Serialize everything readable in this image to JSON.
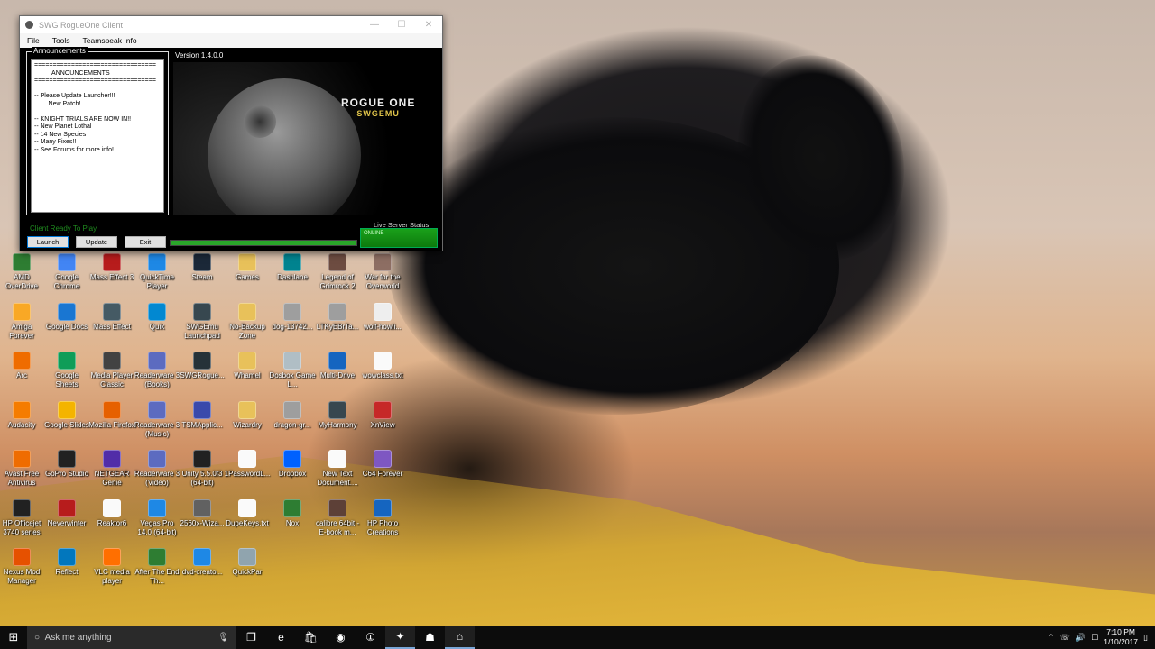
{
  "window": {
    "title": "SWG RogueOne Client",
    "controls": [
      "—",
      "☐",
      "✕"
    ],
    "menu": [
      "File",
      "Tools",
      "Teamspeak Info"
    ],
    "version": "Version 1.4.0.0",
    "announcements_label": "Announcements",
    "announcements_text": "=================================\n          ANNOUNCEMENTS\n=================================\n\n-- Please Update Launcher!!!\n        New Patch!\n\n-- KNIGHT TRIALS ARE NOW IN!!\n-- New Planet Lothal\n-- 14 New Species\n-- Many Fixes!!\n-- See Forums for more info!",
    "logo_line1": "ROGUE ONE",
    "logo_line2": "SWGEMU",
    "status": "Client Ready To Play",
    "buttons": {
      "launch": "Launch",
      "update": "Update",
      "exit": "Exit"
    },
    "progress_fraction": 1.0,
    "server_status_label": "Live Server Status",
    "server_status_value": "ONLINE"
  },
  "desktop_icons": [
    {
      "label": "AMD OverDrive",
      "color": "#2e7d32",
      "icon": "amd-icon"
    },
    {
      "label": "Google Chrome",
      "color": "#4285f4",
      "icon": "chrome-icon"
    },
    {
      "label": "Mass Effect 3",
      "color": "#b71c1c",
      "icon": "mass-effect-3-icon"
    },
    {
      "label": "QuickTime Player",
      "color": "#1e88e5",
      "icon": "quicktime-icon"
    },
    {
      "label": "Steam",
      "color": "#1b2838",
      "icon": "steam-icon"
    },
    {
      "label": "Games",
      "color": "#e8c15a",
      "icon": "folder-icon"
    },
    {
      "label": "Dashlane",
      "color": "#00838f",
      "icon": "dashlane-icon"
    },
    {
      "label": "Legend of Grimrock 2",
      "color": "#6d4c41",
      "icon": "grimrock-icon"
    },
    {
      "label": "War for the Overworld",
      "color": "#8d6e63",
      "icon": "wftow-icon"
    },
    {
      "label": "Amiga Forever",
      "color": "#f9a825",
      "icon": "amiga-icon"
    },
    {
      "label": "Google Docs",
      "color": "#1976d2",
      "icon": "docs-icon"
    },
    {
      "label": "Mass Effect",
      "color": "#455a64",
      "icon": "mass-effect-icon"
    },
    {
      "label": "Quik",
      "color": "#0288d1",
      "icon": "quik-icon"
    },
    {
      "label": "SWGEmu Launchpad",
      "color": "#37474f",
      "icon": "swgemu-icon"
    },
    {
      "label": "No-Backup Zone",
      "color": "#e8c15a",
      "icon": "folder-icon"
    },
    {
      "label": "dog-13742...",
      "color": "#9e9e9e",
      "icon": "image-file-icon"
    },
    {
      "label": "LTKyEBrTa...",
      "color": "#9e9e9e",
      "icon": "image-file-icon"
    },
    {
      "label": "wolf-howli...",
      "color": "#eeeeee",
      "icon": "image-file-icon"
    },
    {
      "label": "Arc",
      "color": "#ef6c00",
      "icon": "arc-icon"
    },
    {
      "label": "Google Sheets",
      "color": "#0f9d58",
      "icon": "sheets-icon"
    },
    {
      "label": "Media Player Classic",
      "color": "#424242",
      "icon": "mpc-icon"
    },
    {
      "label": "Readerware 3 (Books)",
      "color": "#5c6bc0",
      "icon": "readerware-icon"
    },
    {
      "label": "SWGRogue...",
      "color": "#263238",
      "icon": "swgrogue-icon"
    },
    {
      "label": "Whamel",
      "color": "#e8c15a",
      "icon": "folder-icon"
    },
    {
      "label": "Dosbox Game L...",
      "color": "#b0bec5",
      "icon": "dosbox-icon"
    },
    {
      "label": "Multi-Drive",
      "color": "#1565c0",
      "icon": "multi-drive-icon"
    },
    {
      "label": "wowclass.txt",
      "color": "#fafafa",
      "icon": "text-file-icon"
    },
    {
      "label": "Audacity",
      "color": "#f57c00",
      "icon": "audacity-icon"
    },
    {
      "label": "Google Slides",
      "color": "#f4b400",
      "icon": "slides-icon"
    },
    {
      "label": "Mozilla Firefox",
      "color": "#e66000",
      "icon": "firefox-icon"
    },
    {
      "label": "Readerware 3 (Music)",
      "color": "#5c6bc0",
      "icon": "readerware-icon"
    },
    {
      "label": "TSMApplic...",
      "color": "#3949ab",
      "icon": "tsm-icon"
    },
    {
      "label": "Wizardry",
      "color": "#e8c15a",
      "icon": "folder-icon"
    },
    {
      "label": "dragon-gr...",
      "color": "#9e9e9e",
      "icon": "image-file-icon"
    },
    {
      "label": "MyHarmony",
      "color": "#37474f",
      "icon": "myharmony-icon"
    },
    {
      "label": "XnView",
      "color": "#c62828",
      "icon": "xnview-icon"
    },
    {
      "label": "Avast Free Antivirus",
      "color": "#ef6c00",
      "icon": "avast-icon"
    },
    {
      "label": "GoPro Studio",
      "color": "#212121",
      "icon": "gopro-icon"
    },
    {
      "label": "NETGEAR Genie",
      "color": "#512da8",
      "icon": "netgear-icon"
    },
    {
      "label": "Readerware 3 (Video)",
      "color": "#5c6bc0",
      "icon": "readerware-icon"
    },
    {
      "label": "Unity 5.5.0f3 (64-bit)",
      "color": "#212121",
      "icon": "unity-icon"
    },
    {
      "label": "1PasswordL...",
      "color": "#fafafa",
      "icon": "text-file-icon"
    },
    {
      "label": "Dropbox",
      "color": "#0061fe",
      "icon": "dropbox-icon"
    },
    {
      "label": "New Text Document....",
      "color": "#fafafa",
      "icon": "text-file-icon"
    },
    {
      "label": "C64 Forever",
      "color": "#7e57c2",
      "icon": "c64-icon"
    },
    {
      "label": "HP Officejet 3740 series",
      "color": "#212121",
      "icon": "printer-icon"
    },
    {
      "label": "Neverwinter",
      "color": "#b71c1c",
      "icon": "neverwinter-icon"
    },
    {
      "label": "Reaktor6",
      "color": "#fafafa",
      "icon": "reaktor-icon"
    },
    {
      "label": "Vegas Pro 14.0 (64-bit)",
      "color": "#1e88e5",
      "icon": "vegas-icon"
    },
    {
      "label": "2560x-Wiza...",
      "color": "#616161",
      "icon": "image-file-icon"
    },
    {
      "label": "DupeKeys.txt",
      "color": "#fafafa",
      "icon": "text-file-icon"
    },
    {
      "label": "Nox",
      "color": "#2e7d32",
      "icon": "nox-icon"
    },
    {
      "label": "calibre 64bit - E-book m...",
      "color": "#5d4037",
      "icon": "calibre-icon"
    },
    {
      "label": "HP Photo Creations",
      "color": "#1565c0",
      "icon": "hp-photo-icon"
    },
    {
      "label": "Nexus Mod Manager",
      "color": "#e65100",
      "icon": "nexus-icon"
    },
    {
      "label": "Reflect",
      "color": "#0277bd",
      "icon": "reflect-icon"
    },
    {
      "label": "VLC media player",
      "color": "#ff6f00",
      "icon": "vlc-icon"
    },
    {
      "label": "After The End Th...",
      "color": "#2e7d32",
      "icon": "after-the-end-icon"
    },
    {
      "label": "dvd-creato...",
      "color": "#1e88e5",
      "icon": "dvd-icon"
    },
    {
      "label": "QuickPar",
      "color": "#90a4ae",
      "icon": "quickpar-icon"
    }
  ],
  "taskbar": {
    "search_placeholder": "Ask me anything",
    "time": "7:10 PM",
    "date": "1/10/2017"
  }
}
